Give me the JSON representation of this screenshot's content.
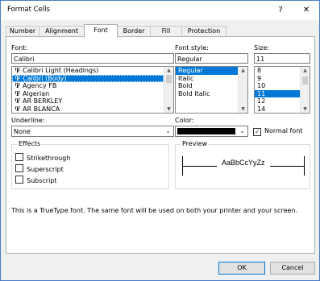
{
  "window": {
    "title": "Format Cells",
    "help_glyph": "?",
    "close_glyph": "✕"
  },
  "tabs": [
    {
      "label": "Number"
    },
    {
      "label": "Alignment"
    },
    {
      "label": "Font"
    },
    {
      "label": "Border"
    },
    {
      "label": "Fill"
    },
    {
      "label": "Protection"
    }
  ],
  "font": {
    "label": "Font:",
    "value": "Calibri",
    "list": [
      "Calibri Light (Headings)",
      "Calibri (Body)",
      "Agency FB",
      "Algerian",
      "AR BERKLEY",
      "AR BLANCA"
    ],
    "tt_glyph": "ꞋF"
  },
  "font_style": {
    "label": "Font style:",
    "value": "Regular",
    "list": [
      "Regular",
      "Italic",
      "Bold",
      "Bold Italic"
    ]
  },
  "size": {
    "label": "Size:",
    "value": "11",
    "list": [
      "8",
      "9",
      "10",
      "11",
      "12",
      "14"
    ]
  },
  "underline": {
    "label": "Underline:",
    "value": "None"
  },
  "color": {
    "label": "Color:",
    "swatch": "#000000",
    "normal_font_label": "Normal font",
    "normal_font_checked": "✓"
  },
  "effects": {
    "title": "Effects",
    "items": [
      "Strikethrough",
      "Superscript",
      "Subscript"
    ]
  },
  "preview": {
    "title": "Preview",
    "sample": "AaBbCcYyZz"
  },
  "info_text": "This is a TrueType font.  The same font will be used on both your printer and your screen.",
  "buttons": {
    "ok": "OK",
    "cancel": "Cancel"
  },
  "colors": {
    "selection": "#0078d7",
    "border_accent": "#4a7cc7"
  }
}
